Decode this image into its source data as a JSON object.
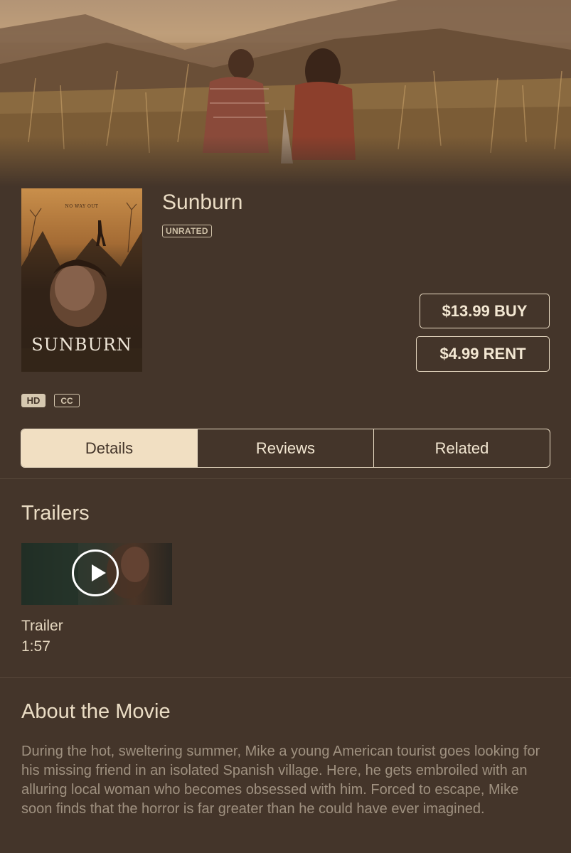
{
  "movie": {
    "title": "Sunburn",
    "rating": "UNRATED",
    "poster_title": "SUNBURN",
    "poster_tagline": "NO WAY OUT"
  },
  "purchase": {
    "buy_label": "$13.99 BUY",
    "rent_label": "$4.99 RENT"
  },
  "badges": {
    "hd": "HD",
    "cc": "CC"
  },
  "tabs": [
    {
      "label": "Details",
      "active": true
    },
    {
      "label": "Reviews",
      "active": false
    },
    {
      "label": "Related",
      "active": false
    }
  ],
  "trailers": {
    "heading": "Trailers",
    "items": [
      {
        "label": "Trailer",
        "duration": "1:57"
      }
    ]
  },
  "about": {
    "heading": "About the Movie",
    "text": "During the hot, sweltering summer, Mike a young American tourist goes looking for his missing friend in an isolated Spanish village. Here, he gets embroiled with an alluring local woman who becomes obsessed with him. Forced to escape, Mike soon finds that the horror is far greater than he could have ever imagined."
  },
  "colors": {
    "background": "#44352a",
    "accent": "#f1dfc2",
    "text": "#eadcc4",
    "muted_text": "#9f9180"
  }
}
